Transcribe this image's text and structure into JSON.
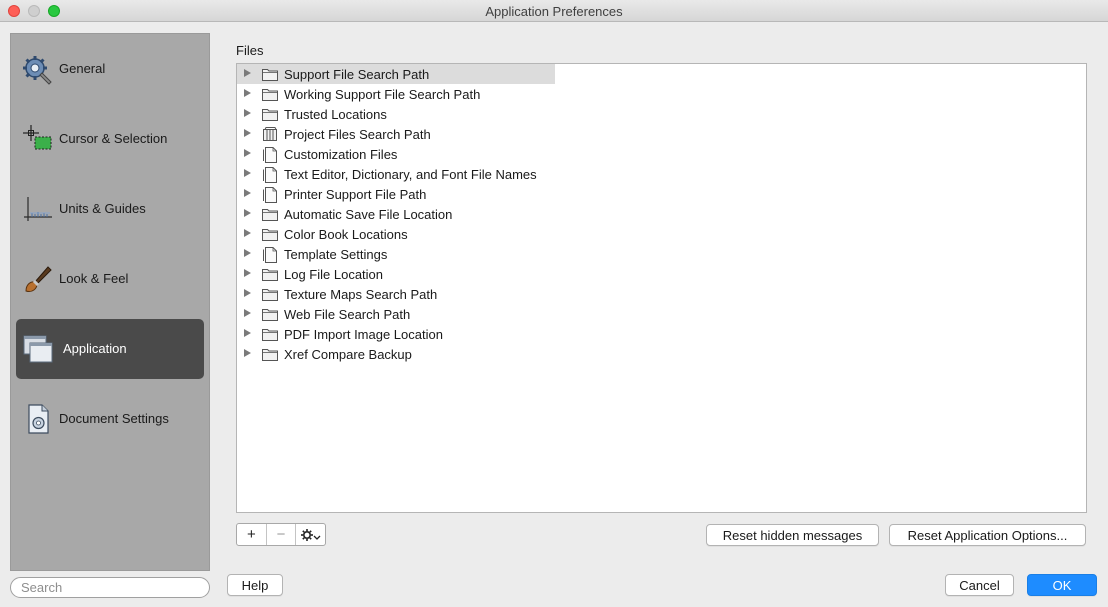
{
  "window": {
    "title": "Application Preferences"
  },
  "sidebar": {
    "items": [
      {
        "label": "General",
        "icon": "gear-icon"
      },
      {
        "label": "Cursor & Selection",
        "icon": "cursor-selection-icon"
      },
      {
        "label": "Units & Guides",
        "icon": "units-guides-icon"
      },
      {
        "label": "Look & Feel",
        "icon": "brush-icon"
      },
      {
        "label": "Application",
        "icon": "application-windows-icon",
        "selected": true
      },
      {
        "label": "Document Settings",
        "icon": "document-settings-icon"
      }
    ],
    "search_placeholder": "Search"
  },
  "main": {
    "section_label": "Files",
    "tree_items": [
      {
        "label": "Support File Search Path",
        "icon": "folder-icon",
        "selected": true
      },
      {
        "label": "Working Support File Search Path",
        "icon": "folder-icon"
      },
      {
        "label": "Trusted Locations",
        "icon": "folder-icon"
      },
      {
        "label": "Project Files Search Path",
        "icon": "project-files-icon"
      },
      {
        "label": "Customization Files",
        "icon": "document-icon"
      },
      {
        "label": "Text Editor, Dictionary, and Font File Names",
        "icon": "document-icon"
      },
      {
        "label": "Printer Support File Path",
        "icon": "document-icon"
      },
      {
        "label": "Automatic Save File Location",
        "icon": "folder-icon"
      },
      {
        "label": "Color Book Locations",
        "icon": "folder-icon"
      },
      {
        "label": "Template Settings",
        "icon": "document-icon"
      },
      {
        "label": "Log File Location",
        "icon": "folder-icon"
      },
      {
        "label": "Texture Maps Search Path",
        "icon": "folder-icon"
      },
      {
        "label": "Web File Search Path",
        "icon": "folder-icon"
      },
      {
        "label": "PDF Import Image Location",
        "icon": "folder-icon"
      },
      {
        "label": "Xref Compare Backup",
        "icon": "folder-icon"
      }
    ]
  },
  "toolbar": {
    "add_label": "+",
    "remove_label": "−",
    "reset_hidden_label": "Reset hidden messages",
    "reset_options_label": "Reset Application Options..."
  },
  "footer": {
    "help_label": "Help",
    "cancel_label": "Cancel",
    "ok_label": "OK"
  },
  "colors": {
    "accent": "#1e8cff",
    "sidebar_bg": "#a8a8a8",
    "sidebar_selected": "#4a4a4a",
    "row_selected": "#dcdcdc"
  }
}
